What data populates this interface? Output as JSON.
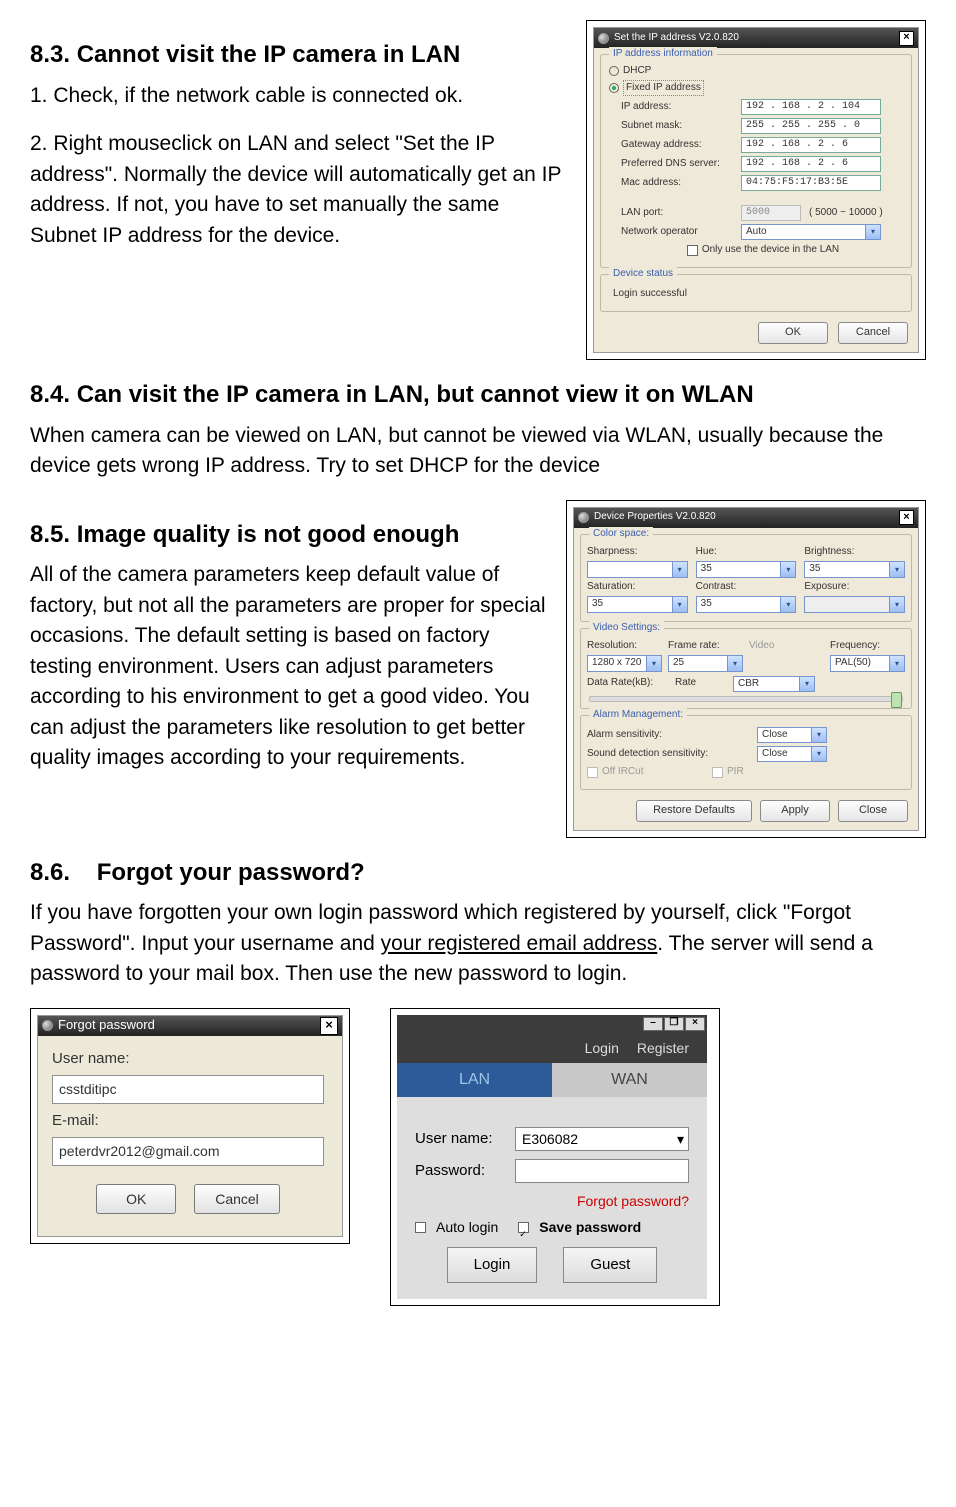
{
  "s83": {
    "heading": "8.3. Cannot visit the IP camera in LAN",
    "p1": "1. Check, if the network cable is connected ok.",
    "p2": "2. Right mouseclick on LAN and select \"Set the IP address\". Normally the device will automatically get an IP address. If not, you have to set manually the same Subnet IP address for the device."
  },
  "dlg_ip": {
    "title": "Set the IP address   V2.0.820",
    "grp_info": "IP address information",
    "opt_dhcp": "DHCP",
    "opt_fixed": "Fixed IP address",
    "lbl_ip": "IP address:",
    "val_ip": "192 . 168  .  2   . 104",
    "lbl_mask": "Subnet mask:",
    "val_mask": "255 . 255 . 255 .   0",
    "lbl_gw": "Gateway address:",
    "val_gw": "192 . 168 .   2   .   6",
    "lbl_dns": "Preferred DNS server:",
    "val_dns": "192 . 168  .  2   .   6",
    "lbl_mac": "Mac address:",
    "val_mac": "04:75:F5:17:B3:5E",
    "lbl_lanport": "LAN port:",
    "val_lanport": "5000",
    "hint_lanport": "( 5000 ~ 10000 )",
    "lbl_netop": "Network operator",
    "val_netop": "Auto",
    "chk_onlylan": "Only use the device in the LAN",
    "grp_status": "Device status",
    "status_text": "Login successful",
    "btn_ok": "OK",
    "btn_cancel": "Cancel"
  },
  "s84": {
    "heading": "8.4. Can visit the IP camera in LAN, but cannot view it on WLAN",
    "p1": "When camera can be viewed on LAN, but cannot be viewed via WLAN, usually because the device gets wrong IP address. Try to set DHCP for the device"
  },
  "s85": {
    "heading": "8.5. Image quality is not good enough",
    "p1": "All of the camera parameters keep default value of factory, but not all the parameters are proper for special occasions. The default setting is based on factory testing environment. Users can adjust parameters according to his environment to get a good video. You can adjust the parameters like resolution to get better quality images according to your requirements."
  },
  "dlg_props": {
    "title": "Device Properties V2.0.820",
    "grp_color": "Color space:",
    "lbl_sharp": "Sharpness:",
    "lbl_hue": "Hue:",
    "val_hue": "35",
    "lbl_bright": "Brightness:",
    "val_bright": "35",
    "lbl_sat": "Saturation:",
    "val_sat": "35",
    "lbl_contrast": "Contrast:",
    "val_contrast": "35",
    "lbl_exposure": "Exposure:",
    "grp_video": "Video Settings:",
    "lbl_res": "Resolution:",
    "val_res": "1280 x 720",
    "lbl_fps": "Frame rate:",
    "val_fps": "25",
    "lbl_vid": "Video",
    "lbl_freq": "Frequency:",
    "val_freq": "PAL(50)",
    "lbl_rate": "Data Rate(kB):",
    "lbl_ratemode": "Rate",
    "val_ratemode": "CBR",
    "grp_alarm": "Alarm Management:",
    "lbl_alarm": "Alarm sensitivity:",
    "val_alarm": "Close",
    "lbl_sound": "Sound detection sensitivity:",
    "val_sound": "Close",
    "chk_ircut": "Off IRCut",
    "chk_pir": "PIR",
    "btn_restore": "Restore Defaults",
    "btn_apply": "Apply",
    "btn_close": "Close"
  },
  "s86": {
    "heading": "8.6.    Forgot your password?",
    "p_pre": "If you have forgotten your own login password which registered by yourself, click \"Forgot Password\". Input your username and ",
    "p_under": "your registered email address",
    "p_post": ". The server will send a password to your mail box. Then use the new password to login."
  },
  "dlg_forgot": {
    "title": "Forgot password",
    "lbl_user": "User name:",
    "val_user": "csstditipc",
    "lbl_email": "E-mail:",
    "val_email": "peterdvr2012@gmail.com",
    "btn_ok": "OK",
    "btn_cancel": "Cancel"
  },
  "dlg_login": {
    "link_login": "Login",
    "link_register": "Register",
    "tab_lan": "LAN",
    "tab_wan": "WAN",
    "lbl_user": "User name:",
    "val_user": "E306082",
    "lbl_pass": "Password:",
    "forgot": "Forgot password?",
    "opt_autologin": "Auto login",
    "opt_savepass": "Save password",
    "btn_login": "Login",
    "btn_guest": "Guest"
  }
}
